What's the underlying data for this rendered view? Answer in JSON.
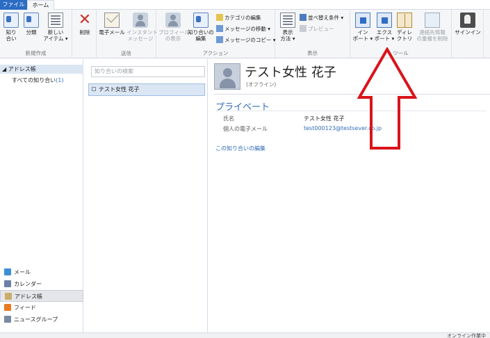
{
  "tabs": {
    "file": "ファイル",
    "home": "ホーム"
  },
  "ribbon": {
    "new_group": {
      "label": "新規作成",
      "contact": "知り\n合い",
      "category": "分類",
      "new_item": "新しい\nアイテム ▾"
    },
    "delete": "削除",
    "send_group": {
      "label": "送信",
      "email": "電子メール",
      "im": "インスタント\nメッセージ"
    },
    "action_group": {
      "label": "アクション",
      "profile": "プロフィール\nの表示",
      "edit_contact": "知り合いの\n編集",
      "edit_category": "カテゴリの編集",
      "move_message": "メッセージの移動 ▾",
      "copy_message": "メッセージのコピー ▾"
    },
    "view_group": {
      "label": "表示",
      "view_mode": "表示\n方法 ▾",
      "sort": "並べ替え条件 ▾",
      "preview": "プレビュー"
    },
    "tools_group": {
      "label": "ツール",
      "import": "イン\nポート ▾",
      "export": "エクス\nポート ▾",
      "directory": "ディレ\nクトリ",
      "dedupe": "連絡先情報\nの重複を削除"
    },
    "signin": "サインイン"
  },
  "left_nav": {
    "root": "アドレス帳",
    "all_contacts": "すべての知り合い",
    "all_contacts_count": "(1)",
    "items": [
      {
        "label": "メール",
        "color": "#3b8fd6"
      },
      {
        "label": "カレンダー",
        "color": "#6b7fa8"
      },
      {
        "label": "アドレス帳",
        "color": "#c9ad6b",
        "selected": true
      },
      {
        "label": "フィード",
        "color": "#e87a22"
      },
      {
        "label": "ニュースグループ",
        "color": "#7a8aa0"
      }
    ]
  },
  "middle": {
    "search_placeholder": "知り合いの検索",
    "contacts": [
      "テスト女性 花子"
    ]
  },
  "detail": {
    "name": "テスト女性 花子",
    "status": "(オフライン)",
    "section": "プライベート",
    "fields": [
      {
        "label": "氏名",
        "value": "テスト女性 花子",
        "link": false
      },
      {
        "label": "個人の電子メール",
        "value": "test000123@testsever.co.jp",
        "link": true
      }
    ],
    "edit_link": "この知り合いの編集"
  },
  "annotation": {
    "color": "#d9141b"
  },
  "status_bar": {
    "text": "オンライン作業中"
  }
}
